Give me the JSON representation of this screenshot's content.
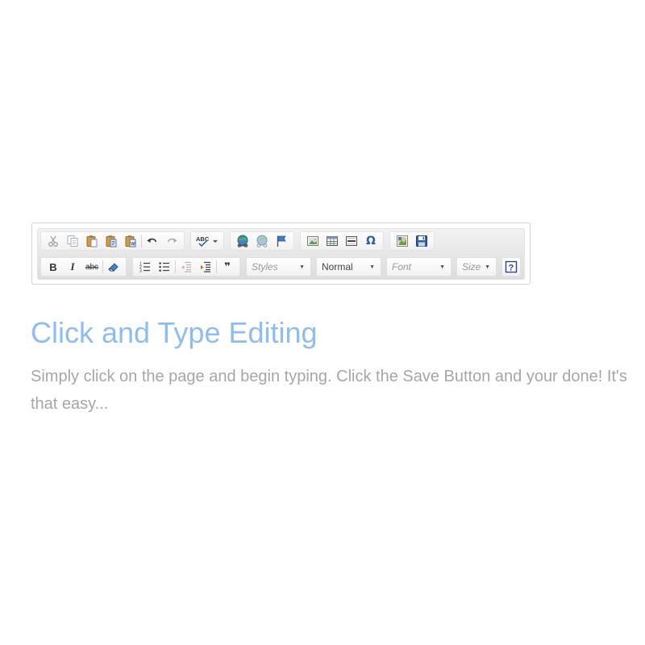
{
  "toolbar": {
    "row1_groups": [
      [
        "cut-icon",
        "copy-icon",
        "paste-icon",
        "paste-text-icon",
        "paste-word-icon",
        "undo-icon",
        "redo-icon"
      ],
      [
        "spellcheck-icon"
      ],
      [
        "link-icon",
        "unlink-icon",
        "anchor-icon"
      ],
      [
        "image-icon",
        "table-icon",
        "horizontal-rule-icon",
        "special-char-icon"
      ],
      [
        "insert-media-icon",
        "save-icon"
      ]
    ],
    "spellcheck_label": "ABC",
    "special_char_glyph": "Ω",
    "bold_label": "B",
    "italic_label": "I",
    "strike_label": "abc",
    "blockquote_glyph": "❞",
    "help_glyph": "?",
    "combos": {
      "styles": "Styles",
      "format": "Normal",
      "font": "Font",
      "size": "Size"
    }
  },
  "content": {
    "title": "Click and Type Editing",
    "body": "Simply click on the page and begin typing. Click the Save Button and your done! It's that easy..."
  }
}
